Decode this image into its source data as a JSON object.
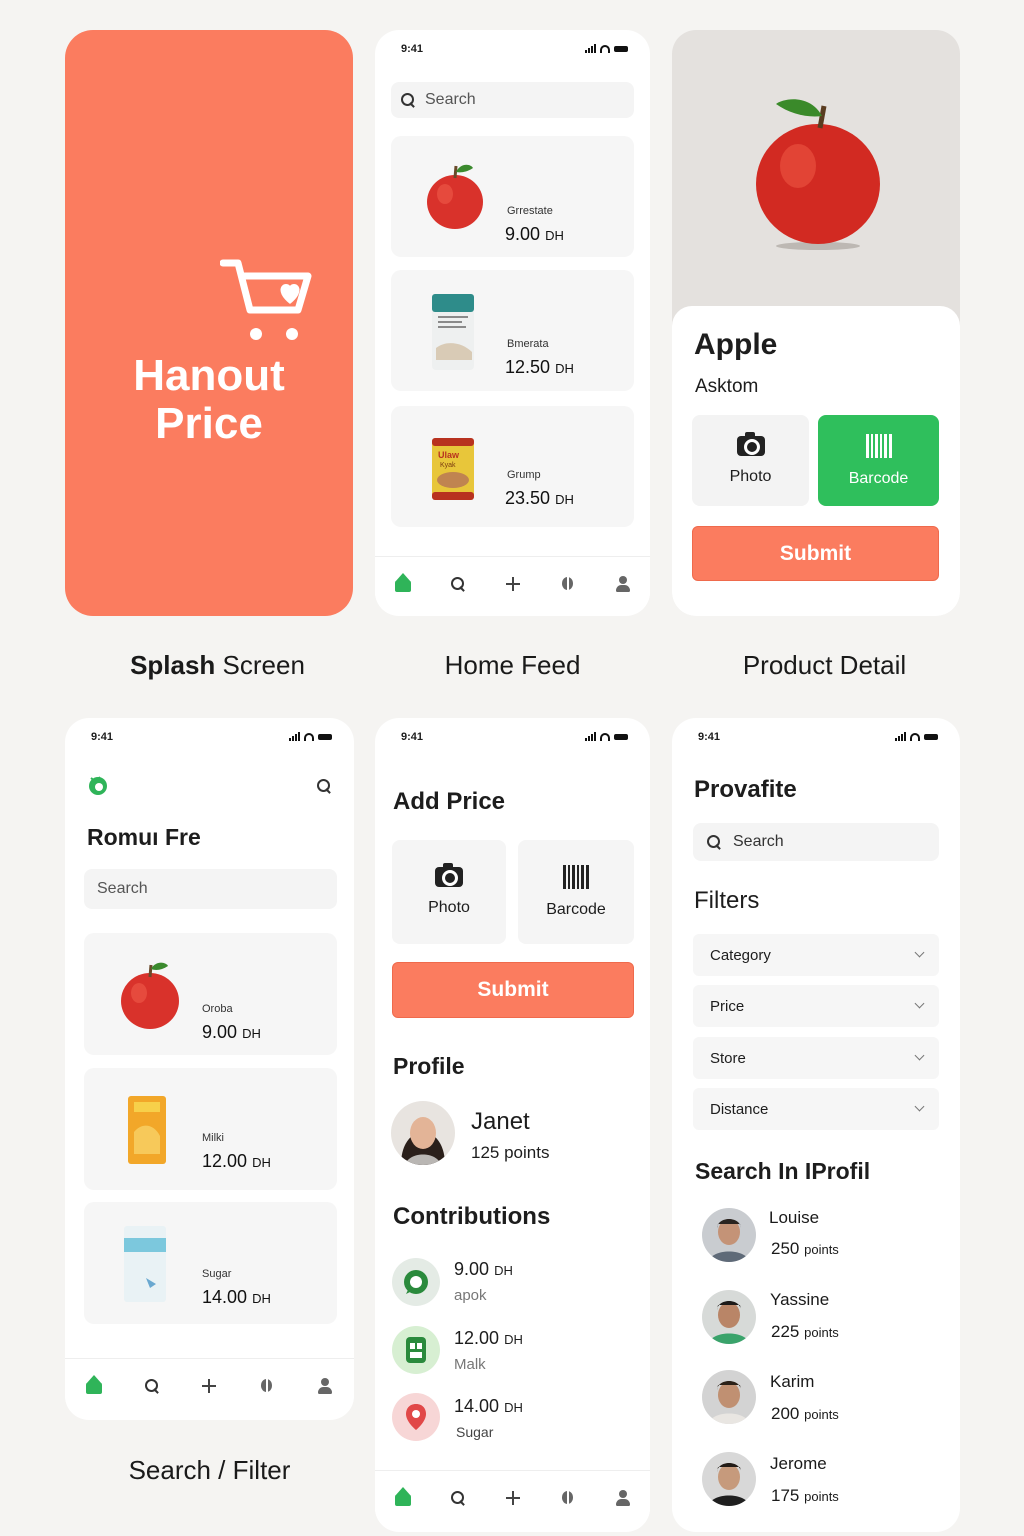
{
  "status_time": "9:41",
  "splash": {
    "brand_line1": "Hanout",
    "brand_line2": "Price",
    "caption_bold": "Splash",
    "caption_rest": " Screen"
  },
  "home": {
    "caption": "Home Feed",
    "search_placeholder": "Search",
    "items": [
      {
        "name": "Grrestate",
        "price": "9.00",
        "currency": "DH"
      },
      {
        "name": "Bmerata",
        "price": "12.50",
        "currency": "DH"
      },
      {
        "name": "Grump",
        "price": "23.50",
        "currency": "DH"
      }
    ],
    "package_texts": {
      "can": "Ulaw",
      "can_sub": "Kyak"
    }
  },
  "detail": {
    "caption": "Product Detail",
    "title": "Apple",
    "subtitle": "Asktom",
    "photo_label": "Photo",
    "barcode_label": "Barcode",
    "submit_label": "Submit"
  },
  "search_screen": {
    "caption": "Search / Filter",
    "title": "Romuı Fre",
    "search_placeholder": "Search",
    "items": [
      {
        "name": "Oroba",
        "price": "9.00",
        "currency": "DH"
      },
      {
        "name": "Milki",
        "price": "12.00",
        "currency": "DH"
      },
      {
        "name": "Sugar",
        "price": "14.00",
        "currency": "DH"
      }
    ]
  },
  "add_price": {
    "title": "Add Price",
    "photo_label": "Photo",
    "barcode_label": "Barcode",
    "submit_label": "Submit",
    "profile_heading": "Profile",
    "profile_name": "Janet",
    "profile_points": "125 points",
    "contrib_heading": "Contributions",
    "contributions": [
      {
        "price": "9.00",
        "currency": "DH",
        "label": "apok"
      },
      {
        "price": "12.00",
        "currency": "DH",
        "label": "Malk"
      },
      {
        "price": "14.00",
        "currency": "DH",
        "label": "Sugar"
      }
    ]
  },
  "provafite": {
    "title": "Provafite",
    "search_placeholder": "Search",
    "filters_heading": "Filters",
    "filters": [
      "Category",
      "Price",
      "Store",
      "Distance"
    ],
    "people_heading": "Search In IProfil",
    "people": [
      {
        "name": "Louise",
        "score": "250",
        "unit": "points"
      },
      {
        "name": "Yassine",
        "score": "225",
        "unit": "points"
      },
      {
        "name": "Karim",
        "score": "200",
        "unit": "points"
      },
      {
        "name": "Jerome",
        "score": "175",
        "unit": "points"
      }
    ]
  },
  "colors": {
    "accent": "#fb7c5f",
    "green": "#2fb459"
  }
}
